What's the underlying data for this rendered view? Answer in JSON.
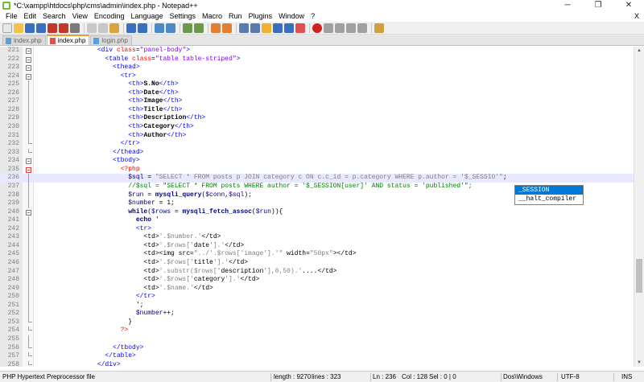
{
  "window": {
    "title": "*C:\\xampp\\htdocs\\php\\cms\\admin\\index.php - Notepad++",
    "minimize": "─",
    "maximize": "❐",
    "close": "✕"
  },
  "menu": {
    "items": [
      "File",
      "Edit",
      "Search",
      "View",
      "Encoding",
      "Language",
      "Settings",
      "Macro",
      "Run",
      "Plugins",
      "Window",
      "?"
    ],
    "close_doc": "X"
  },
  "tabs": [
    {
      "label": "index.php",
      "active": false
    },
    {
      "label": "index.php",
      "active": true
    },
    {
      "label": "login.php",
      "active": false
    }
  ],
  "editor": {
    "current_line": 236,
    "lines": [
      {
        "n": "221",
        "code": "<div class=\"panel-body\">"
      },
      {
        "n": "222",
        "code": "<table class=\"table table-striped\">"
      },
      {
        "n": "223",
        "code": "<thead>"
      },
      {
        "n": "224",
        "code": "<tr>"
      },
      {
        "n": "225",
        "code": "<th>S.No</th>"
      },
      {
        "n": "226",
        "code": "<th>Date</th>"
      },
      {
        "n": "227",
        "code": "<th>Image</th>"
      },
      {
        "n": "228",
        "code": "<th>Title</th>"
      },
      {
        "n": "229",
        "code": "<th>Description</th>"
      },
      {
        "n": "230",
        "code": "<th>Category</th>"
      },
      {
        "n": "231",
        "code": "<th>Author</th>"
      },
      {
        "n": "232",
        "code": "</tr>"
      },
      {
        "n": "233",
        "code": "</thead>"
      },
      {
        "n": "234",
        "code": "<tbody>"
      },
      {
        "n": "235",
        "code": "<?php"
      },
      {
        "n": "236",
        "code": "$sql = \"SELECT * FROM posts p JOIN category c ON c.c_id = p.category WHERE p.author = '$_SESSIO'\";"
      },
      {
        "n": "237",
        "code": "//$sql = \"SELECT * FROM posts WHERE author = '$_SESSION[user]' AND status = 'published'\";"
      },
      {
        "n": "238",
        "code": "$run = mysqli_query($conn,$sql);"
      },
      {
        "n": "239",
        "code": "$number = 1;"
      },
      {
        "n": "240",
        "code": "while($rows = mysqli_fetch_assoc($run)){"
      },
      {
        "n": "241",
        "code": "echo '"
      },
      {
        "n": "242",
        "code": "<tr>"
      },
      {
        "n": "243",
        "code": "<td>'.$number.'</td>"
      },
      {
        "n": "244",
        "code": "<td>'.$rows['date'].'</td>"
      },
      {
        "n": "245",
        "code": "<td><img src=\"../'.$rows['image'].'\" width=\"50px\"></td>"
      },
      {
        "n": "246",
        "code": "<td>'.$rows['title'].'</td>"
      },
      {
        "n": "247",
        "code": "<td>'.substr($rows['description'],0,50).'....</td>"
      },
      {
        "n": "248",
        "code": "<td>'.$rows['category'].'</td>"
      },
      {
        "n": "249",
        "code": "<td>'.$name.'</td>"
      },
      {
        "n": "250",
        "code": "</tr>"
      },
      {
        "n": "251",
        "code": "';"
      },
      {
        "n": "252",
        "code": "$number++;"
      },
      {
        "n": "253",
        "code": "}"
      },
      {
        "n": "254",
        "code": "?>"
      },
      {
        "n": "255",
        "code": ""
      },
      {
        "n": "256",
        "code": "</tbody>"
      },
      {
        "n": "257",
        "code": "</table>"
      },
      {
        "n": "258",
        "code": "</div>"
      }
    ]
  },
  "autocomplete": {
    "items": [
      {
        "label": "_SESSION",
        "selected": true
      },
      {
        "label": "__halt_compiler",
        "selected": false
      }
    ]
  },
  "status": {
    "file_type": "PHP Hypertext Preprocessor file",
    "length": "length : 9270",
    "lines": "lines : 323",
    "ln": "Ln : 236",
    "col": "Col : 128",
    "sel": "Sel : 0 | 0",
    "eol": "Dos\\Windows",
    "encoding": "UTF-8",
    "mode": "INS"
  },
  "colors": {
    "tag": "#0000ff",
    "attr": "#ff0000",
    "string": "#8000ff",
    "comment": "#008000",
    "current_line": "#e8e8ff",
    "active_tab_accent": "#f0a030"
  }
}
